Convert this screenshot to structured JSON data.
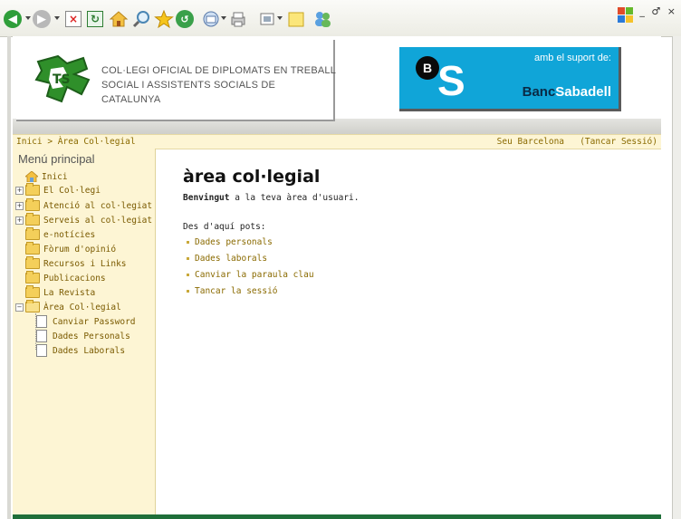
{
  "browser": {
    "icons": [
      "back-icon",
      "forward-icon",
      "stop-icon",
      "refresh-icon",
      "home-icon",
      "search-icon",
      "favorites-icon",
      "history-icon",
      "mail-icon",
      "print-icon",
      "edit-icon",
      "notes-icon",
      "messenger-icon"
    ],
    "window_controls": "_ ♂ ×"
  },
  "header": {
    "org_line1": "COL·LEGI OFICIAL DE DIPLOMATS EN TREBALL",
    "org_line2": "SOCIAL I ASSISTENTS SOCIALS DE CATALUNYA",
    "sponsor_text": "amb el suport de:",
    "bank_part1": "Banc",
    "bank_part2": "Sabadell",
    "bank_letter": "B",
    "bank_s": "S"
  },
  "breadcrumb": {
    "home": "Inici",
    "sep": " > ",
    "current": "Àrea Col·legial",
    "site": "Seu Barcelona",
    "logout": "(Tancar Sessió)"
  },
  "menu": {
    "title": "Menú principal",
    "items": [
      {
        "label": "Inici"
      },
      {
        "label": "El Col·legi"
      },
      {
        "label": "Atenció al col·legiat"
      },
      {
        "label": "Serveis al col·legiat"
      },
      {
        "label": "e-notícies"
      },
      {
        "label": "Fòrum d'opinió"
      },
      {
        "label": "Recursos i Links"
      },
      {
        "label": "Publicacions"
      },
      {
        "label": "La Revista"
      },
      {
        "label": "Àrea Col·legial"
      },
      {
        "label": "Canviar Password"
      },
      {
        "label": "Dades Personals"
      },
      {
        "label": "Dades Laborals"
      }
    ]
  },
  "main": {
    "title": "àrea col·legial",
    "welcome_bold": "Benvingut",
    "welcome_rest": " a la teva àrea d'usuari.",
    "intro": "Des d'aquí pots:",
    "links": [
      {
        "label": "Dades personals"
      },
      {
        "label": "Dades laborals"
      },
      {
        "label": "Canviar la paraula clau"
      },
      {
        "label": "Tancar la sessió"
      }
    ]
  },
  "colors": {
    "accent": "#8a6a00",
    "sidebar_bg": "#fdf5d4",
    "sponsor_bg": "#10a5d8",
    "footer": "#1f6f3a"
  }
}
